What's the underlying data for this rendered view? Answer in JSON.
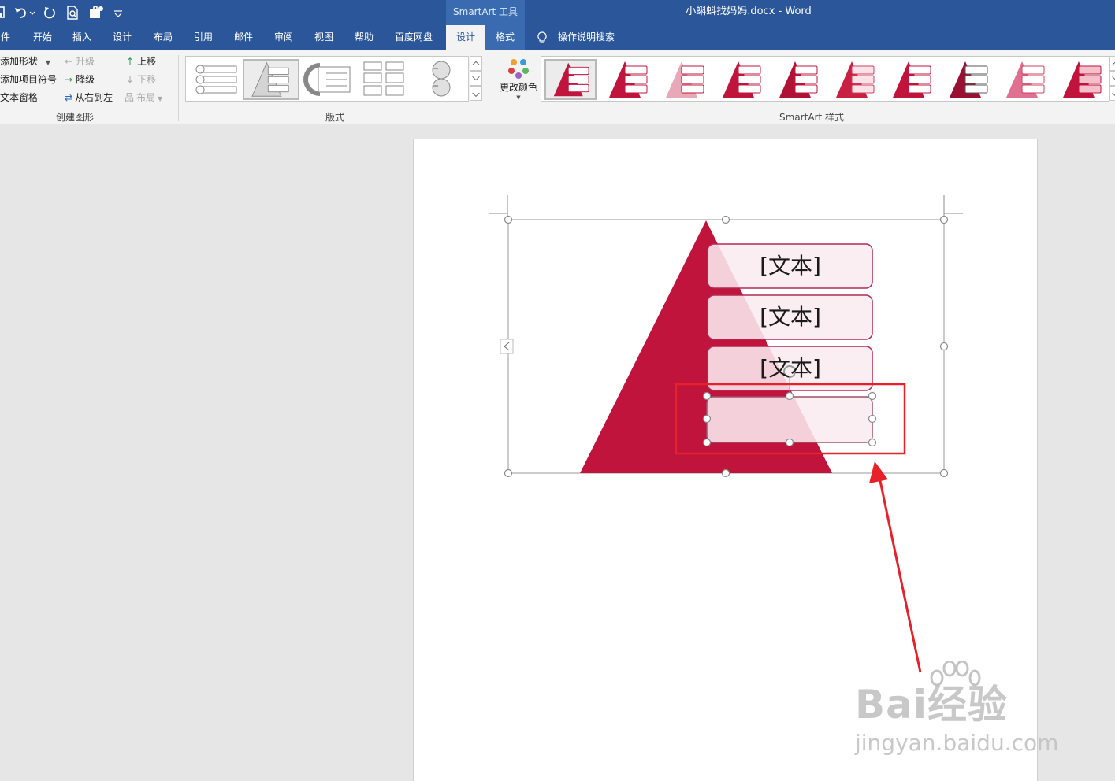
{
  "titlebar": {
    "tools_label": "SmartArt 工具",
    "doc_title": "小蝌蚪找妈妈.docx  -  Word"
  },
  "tabs": [
    {
      "label": "件"
    },
    {
      "label": "开始"
    },
    {
      "label": "插入"
    },
    {
      "label": "设计"
    },
    {
      "label": "布局"
    },
    {
      "label": "引用"
    },
    {
      "label": "邮件"
    },
    {
      "label": "审阅"
    },
    {
      "label": "视图"
    },
    {
      "label": "帮助"
    },
    {
      "label": "百度网盘"
    },
    {
      "label": "设计"
    },
    {
      "label": "格式"
    }
  ],
  "tell_me": "操作说明搜索",
  "ribbon": {
    "create": {
      "add_shape": "添加形状",
      "add_bullet": "添加项目符号",
      "text_pane": "文本窗格",
      "promote": "升级",
      "demote": "降级",
      "rtl": "从右到左",
      "move_up": "上移",
      "move_down": "下移",
      "layout": "布局",
      "group_label": "创建图形"
    },
    "layouts_group_label": "版式",
    "change_colors": "更改颜色",
    "styles_group_label": "SmartArt 样式"
  },
  "smartart": {
    "items": [
      "[文本]",
      "[文本]",
      "[文本]",
      ""
    ]
  },
  "colors": {
    "titlebar": "#2b579a",
    "accent_red": "#c0143c",
    "annotation_red": "#e8202a"
  },
  "watermark": {
    "line1": "Bai经验",
    "line2": "jingyan.baidu.com"
  }
}
